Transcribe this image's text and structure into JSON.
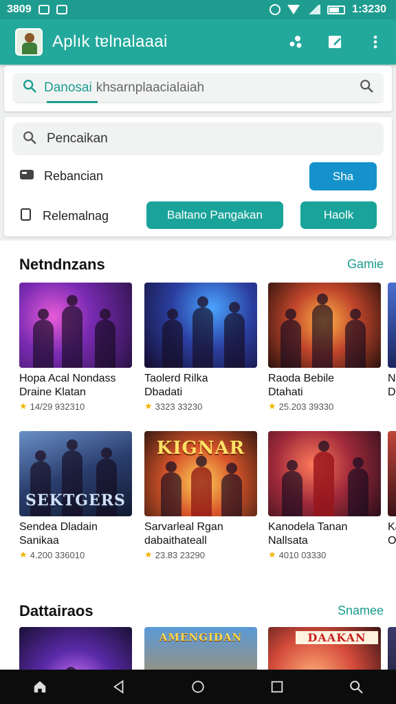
{
  "status_bar": {
    "time": "3809",
    "right_text": "1:3230"
  },
  "app_bar": {
    "title": "Aplık tɐlnalaaai",
    "icons": [
      "cluster-icon",
      "compose-icon",
      "more-vert-icon"
    ]
  },
  "search": {
    "value": "Danosai",
    "placeholder": "khsarnplaacialaiah"
  },
  "filters": {
    "search_label": "Pencaikan",
    "row1_label": "Rebancian",
    "row1_button": "Sha",
    "row2_label": "Relemalnag",
    "row2_button_primary": "Baltano Pangakan",
    "row2_button_secondary": "Haolk"
  },
  "sections": [
    {
      "title": "Netndnzans",
      "link": "Gamie"
    },
    {
      "title": "Dattairaos",
      "link": "Snamee"
    }
  ],
  "games_row1": [
    {
      "title1": "Hopa Acal Nondass",
      "title2": "Draine Klatan",
      "meta": "14/29 932310"
    },
    {
      "title1": "Taolerd Rilka",
      "title2": "Dbadati",
      "meta": "3323 33230"
    },
    {
      "title1": "Raoda Bebile",
      "title2": "Dtahati",
      "meta": "25.203 39330"
    },
    {
      "title1": "Na",
      "title2": "Dr",
      "meta": ""
    }
  ],
  "games_row2": [
    {
      "title1": "Sendea Dladain",
      "title2": "Sanikaa",
      "meta": "4.200 336010",
      "logo": "SEKTGERS"
    },
    {
      "title1": "Sarvarleal Rgan",
      "title2": "dabaithateall",
      "meta": "23.83 23290",
      "logo": "KIGNAR"
    },
    {
      "title1": "Kanodela Tanan",
      "title2": "Nallsata",
      "meta": "4010 03330",
      "logo": ""
    },
    {
      "title1": "Ka",
      "title2": "Or",
      "meta": "",
      "logo": ""
    }
  ],
  "games_row3": [
    {
      "logo": ""
    },
    {
      "logo": "AMENGIDAN"
    },
    {
      "logo": "DAAKAN"
    }
  ],
  "colors": {
    "primary": "#23a99c",
    "accent": "#1a9c8e",
    "blue": "#1592cc",
    "star": "#f2b400"
  }
}
